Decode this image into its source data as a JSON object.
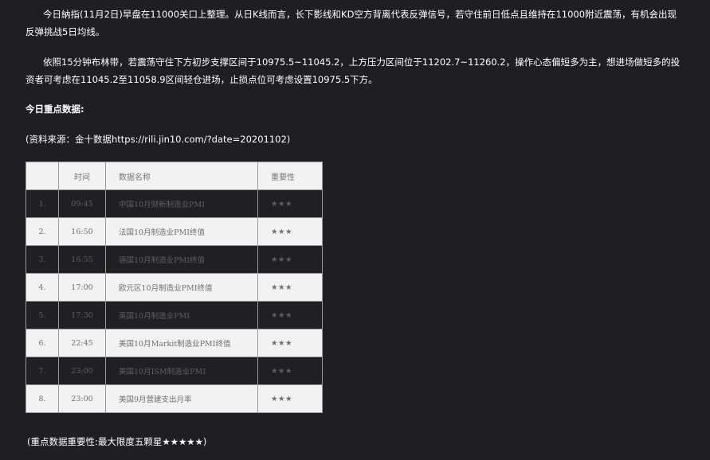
{
  "paragraphs": {
    "p1": "今日納指(11月2日)早盘在11000关口上整理。从日K线而言，长下影线和KD空方背离代表反弹信号，若守住前日低点且维持在11000附近震荡，有机会出现反弹挑战5日均线。",
    "p2": "依照15分钟布林带，若震荡守住下方初步支撑区间于10975.5~11045.2，上方压力区间位于11202.7~11260.2，操作心态偏短多为主，想进场做短多的投资者可考虑在11045.2至11058.9区间轻仓进场，止损点位可考虑设置10975.5下方。"
  },
  "heading": "今日重点数据:",
  "source": "(资料来源：金十数据https://rili.jin10.com/?date=20201102)",
  "table": {
    "headers": [
      "",
      "时间",
      "数据名称",
      "重要性"
    ],
    "rows": [
      {
        "no": "1.",
        "time": "09:45",
        "name": "中国10月财新制造业PMI",
        "importance": "★★★"
      },
      {
        "no": "2.",
        "time": "16:50",
        "name": "法国10月制造业PMI终值",
        "importance": "★★★"
      },
      {
        "no": "3.",
        "time": "16:55",
        "name": "德国10月制造业PMI终值",
        "importance": "★★★"
      },
      {
        "no": "4.",
        "time": "17:00",
        "name": "欧元区10月制造业PMI终值",
        "importance": "★★★"
      },
      {
        "no": "5.",
        "time": "17:30",
        "name": "英国10月制造业PMI",
        "importance": "★★★"
      },
      {
        "no": "6.",
        "time": "22:45",
        "name": "美国10月Markit制造业PMI终值",
        "importance": "★★★"
      },
      {
        "no": "7.",
        "time": "23:00",
        "name": "美国10月ISM制造业PMI",
        "importance": "★★★"
      },
      {
        "no": "8.",
        "time": "23:00",
        "name": "美国9月营建支出月率",
        "importance": "★★★"
      }
    ]
  },
  "footnote": "(重点数据重要性:最大限度五颗星★★★★★)"
}
